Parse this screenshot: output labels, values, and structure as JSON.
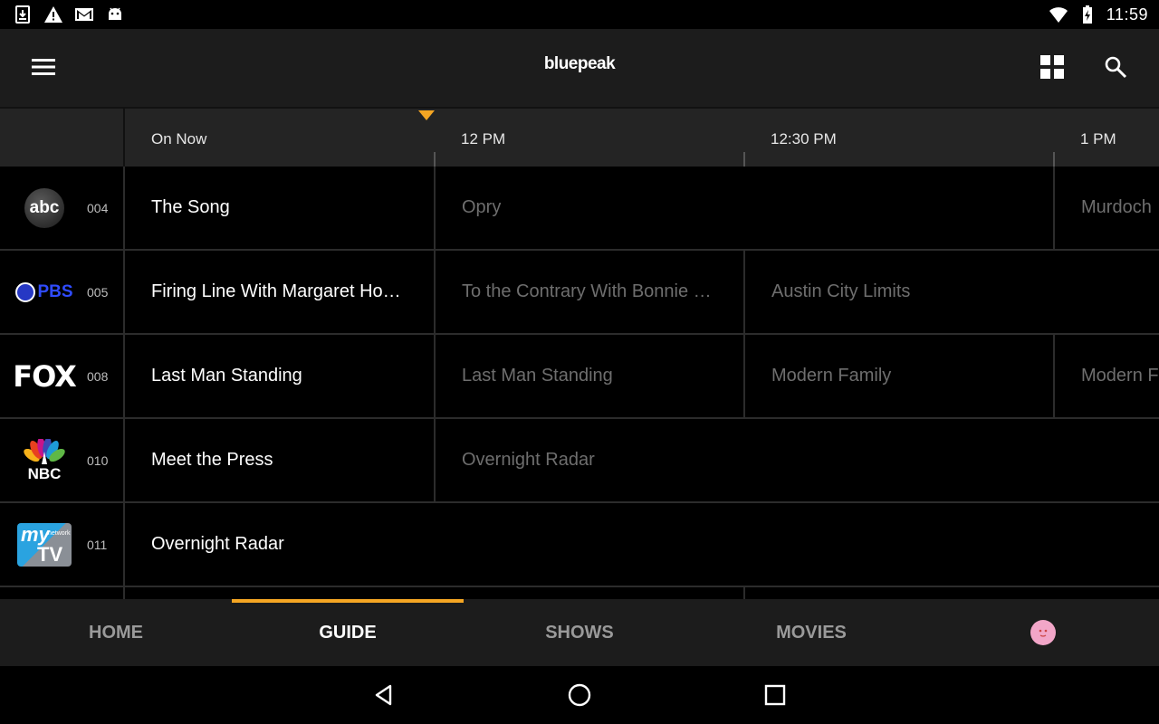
{
  "status_bar": {
    "time": "11:59",
    "icons": [
      "download-icon",
      "warning-icon",
      "gmail-icon",
      "android-icon",
      "wifi-icon",
      "battery-charging-icon"
    ]
  },
  "app_bar": {
    "brand": "bluepeak",
    "icons": [
      "menu-icon",
      "grid-view-icon",
      "search-icon"
    ]
  },
  "guide": {
    "time_slots": [
      "On Now",
      "12 PM",
      "12:30 PM",
      "1 PM"
    ],
    "channels": [
      {
        "logo": "ABC",
        "logo_text": "abc",
        "number": "004",
        "programs": [
          {
            "title": "The Song",
            "state": "now"
          },
          {
            "title": "Opry",
            "state": "future"
          },
          {
            "title": "Murdoch",
            "state": "future"
          }
        ]
      },
      {
        "logo": "PBS",
        "logo_text": "PBS",
        "number": "005",
        "programs": [
          {
            "title": "Firing Line With Margaret Ho…",
            "state": "now"
          },
          {
            "title": "To the Contrary With Bonnie …",
            "state": "future"
          },
          {
            "title": "Austin City Limits",
            "state": "future"
          }
        ]
      },
      {
        "logo": "FOX",
        "logo_text": "FOX",
        "number": "008",
        "programs": [
          {
            "title": "Last Man Standing",
            "state": "now"
          },
          {
            "title": "Last Man Standing",
            "state": "future"
          },
          {
            "title": "Modern Family",
            "state": "future"
          },
          {
            "title": "Modern F",
            "state": "future"
          }
        ]
      },
      {
        "logo": "NBC",
        "logo_text": "NBC",
        "number": "010",
        "programs": [
          {
            "title": "Meet the Press",
            "state": "now"
          },
          {
            "title": "Overnight Radar",
            "state": "future"
          }
        ]
      },
      {
        "logo": "MyNetworkTV",
        "logo_text": "my",
        "logo_sub": "network",
        "logo_tv": "TV",
        "number": "011",
        "programs": [
          {
            "title": "Overnight Radar",
            "state": "now"
          }
        ]
      }
    ]
  },
  "bottom_nav": {
    "tabs": [
      "HOME",
      "GUIDE",
      "SHOWS",
      "MOVIES"
    ],
    "active": "GUIDE",
    "avatar": "profile-avatar-icon"
  },
  "system_nav": {
    "icons": [
      "back-icon",
      "home-icon",
      "recents-icon"
    ]
  },
  "colors": {
    "accent": "#f5a623",
    "appbar_bg": "#1c1c1c",
    "grid_bg": "#000000",
    "future_text": "#6e6e6e",
    "pbs_blue": "#2638c4",
    "abc_bg": "#3a3a3a"
  }
}
